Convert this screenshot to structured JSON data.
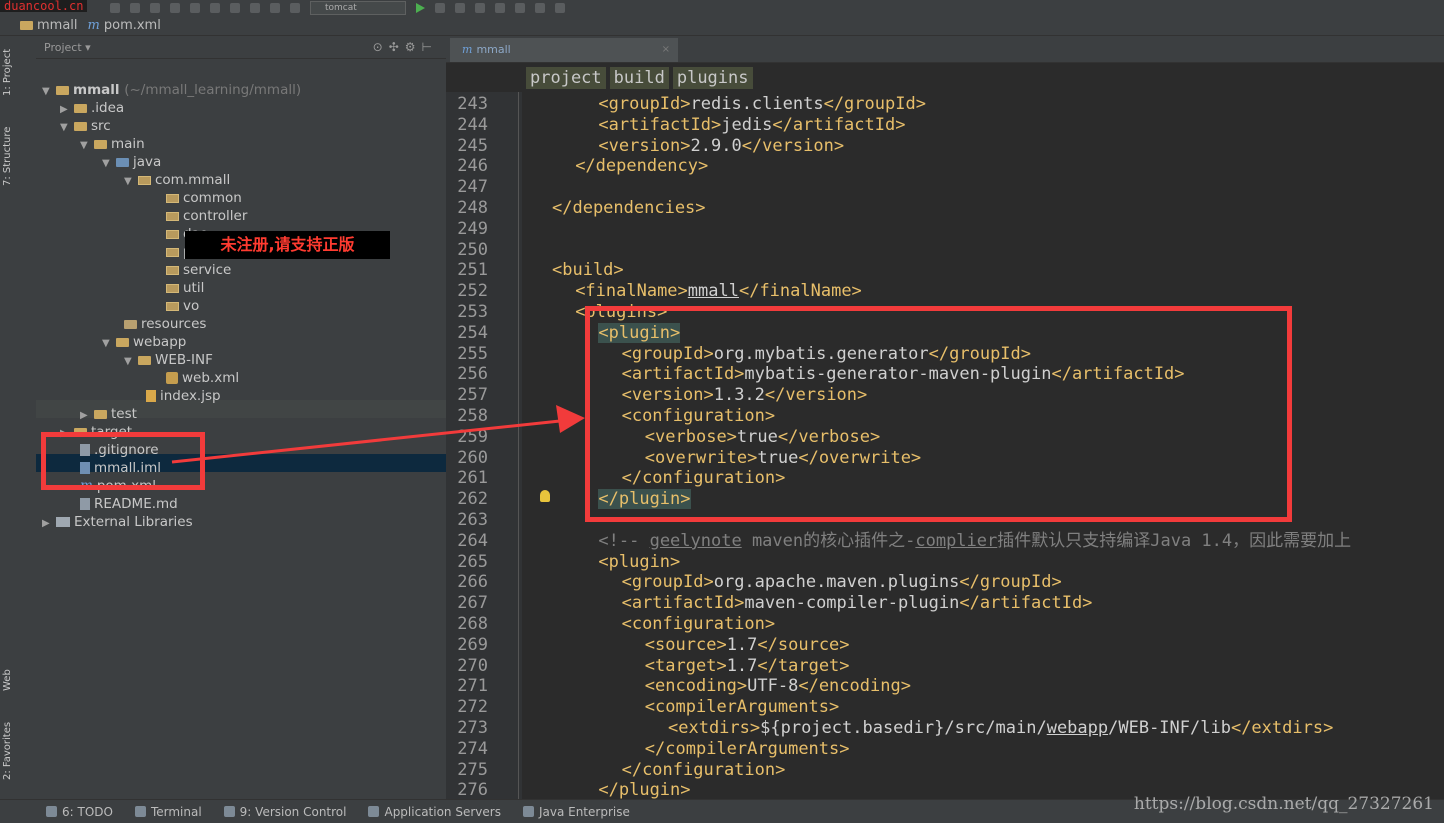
{
  "watermark_top": "duancool.cn",
  "toolbar": {
    "run_config": "tomcat"
  },
  "nav": {
    "project": "mmall",
    "file": "pom.xml"
  },
  "side_tabs": {
    "project": "1: Project",
    "structure": "7: Structure",
    "web": "Web",
    "favorites": "2: Favorites"
  },
  "project_panel": {
    "header": "Project",
    "tree": [
      {
        "label": "mmall",
        "extra": "(~/mmall_learning/mmall)"
      },
      {
        "label": ".idea"
      },
      {
        "label": "src"
      },
      {
        "label": "main"
      },
      {
        "label": "java"
      },
      {
        "label": "com.mmall"
      },
      {
        "label": "common"
      },
      {
        "label": "controller"
      },
      {
        "label": "dao"
      },
      {
        "label": "pojo"
      },
      {
        "label": "service"
      },
      {
        "label": "util"
      },
      {
        "label": "vo"
      },
      {
        "label": "resources"
      },
      {
        "label": "webapp"
      },
      {
        "label": "WEB-INF"
      },
      {
        "label": "web.xml"
      },
      {
        "label": "index.jsp"
      },
      {
        "label": "test"
      },
      {
        "label": "target"
      },
      {
        "label": ".gitignore"
      },
      {
        "label": "mmall.iml"
      },
      {
        "label": "pom.xml"
      },
      {
        "label": "README.md"
      },
      {
        "label": "External Libraries"
      }
    ]
  },
  "unregistered_banner": "未注册,请支持正版",
  "editor": {
    "tab": "mmall",
    "breadcrumbs": [
      "project",
      "build",
      "plugins"
    ],
    "lines": [
      {
        "n": "243",
        "i": 2,
        "t": "<groupId>redis.clients</groupId>"
      },
      {
        "n": "244",
        "i": 2,
        "t": "<artifactId>jedis</artifactId>"
      },
      {
        "n": "245",
        "i": 2,
        "t": "<version>2.9.0</version>"
      },
      {
        "n": "246",
        "i": 1,
        "t": "</dependency>"
      },
      {
        "n": "247",
        "i": 0,
        "t": ""
      },
      {
        "n": "248",
        "i": 0,
        "t": "</dependencies>"
      },
      {
        "n": "249",
        "i": 0,
        "t": ""
      },
      {
        "n": "250",
        "i": 0,
        "t": ""
      },
      {
        "n": "251",
        "i": 0,
        "t": "<build>"
      },
      {
        "n": "252",
        "i": 1,
        "t": "<finalName>mmall</finalName>"
      },
      {
        "n": "253",
        "i": 1,
        "t": "<plugins>"
      },
      {
        "n": "254",
        "i": 2,
        "t": "<plugin>"
      },
      {
        "n": "255",
        "i": 3,
        "t": "<groupId>org.mybatis.generator</groupId>"
      },
      {
        "n": "256",
        "i": 3,
        "t": "<artifactId>mybatis-generator-maven-plugin</artifactId>"
      },
      {
        "n": "257",
        "i": 3,
        "t": "<version>1.3.2</version>"
      },
      {
        "n": "258",
        "i": 3,
        "t": "<configuration>"
      },
      {
        "n": "259",
        "i": 4,
        "t": "<verbose>true</verbose>"
      },
      {
        "n": "260",
        "i": 4,
        "t": "<overwrite>true</overwrite>"
      },
      {
        "n": "261",
        "i": 3,
        "t": "</configuration>"
      },
      {
        "n": "262",
        "i": 2,
        "t": "</plugin>"
      },
      {
        "n": "263",
        "i": 0,
        "t": ""
      },
      {
        "n": "264",
        "i": 2,
        "t": "<!-- geelynote maven的核心插件之-complier插件默认只支持编译Java 1.4，因此需要加上"
      },
      {
        "n": "265",
        "i": 2,
        "t": "<plugin>"
      },
      {
        "n": "266",
        "i": 3,
        "t": "<groupId>org.apache.maven.plugins</groupId>"
      },
      {
        "n": "267",
        "i": 3,
        "t": "<artifactId>maven-compiler-plugin</artifactId>"
      },
      {
        "n": "268",
        "i": 3,
        "t": "<configuration>"
      },
      {
        "n": "269",
        "i": 4,
        "t": "<source>1.7</source>"
      },
      {
        "n": "270",
        "i": 4,
        "t": "<target>1.7</target>"
      },
      {
        "n": "271",
        "i": 4,
        "t": "<encoding>UTF-8</encoding>"
      },
      {
        "n": "272",
        "i": 4,
        "t": "<compilerArguments>"
      },
      {
        "n": "273",
        "i": 5,
        "t": "<extdirs>${project.basedir}/src/main/webapp/WEB-INF/lib</extdirs>"
      },
      {
        "n": "274",
        "i": 4,
        "t": "</compilerArguments>"
      },
      {
        "n": "275",
        "i": 3,
        "t": "</configuration>"
      },
      {
        "n": "276",
        "i": 2,
        "t": "</plugin>"
      }
    ]
  },
  "statusbar": {
    "items": [
      "6: TODO",
      "Terminal",
      "9: Version Control",
      "Application Servers",
      "Java Enterprise"
    ]
  },
  "csdn_watermark": "https://blog.csdn.net/qq_27327261",
  "colors": {
    "tag": "#e8bf6a",
    "annotation_red": "#f23b3b",
    "background": "#2b2b2b"
  }
}
